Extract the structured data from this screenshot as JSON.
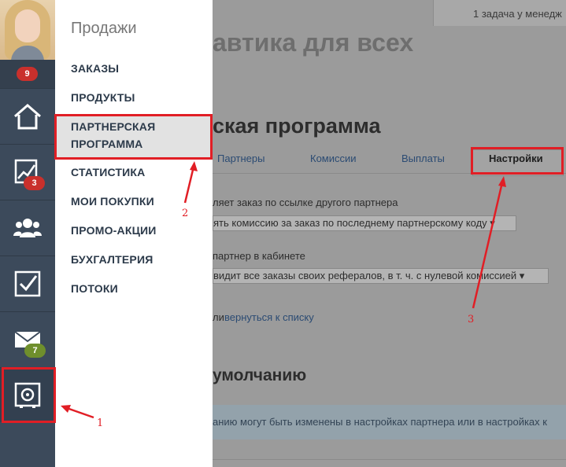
{
  "header": {
    "notice": "1 задача у менедж",
    "page_title": "автика для всех"
  },
  "sidebar": {
    "badges": {
      "top": "9",
      "stats": "3",
      "mail": "7"
    },
    "icons": [
      "home-icon",
      "chart-icon",
      "users-icon",
      "checkbox-icon",
      "mail-icon",
      "safe-icon"
    ]
  },
  "menu": {
    "title": "Продажи",
    "items": [
      "ЗАКАЗЫ",
      "ПРОДУКТЫ",
      "ПАРТНЕРСКАЯ",
      "ПРОГРАММА",
      "СТАТИСТИКА",
      "МОИ ПОКУПКИ",
      "ПРОМО-АКЦИИ",
      "БУХГАЛТЕРИЯ",
      "ПОТОКИ"
    ]
  },
  "main": {
    "section_title": "ская программа",
    "tabs": [
      "Партнеры",
      "Комиссии",
      "Выплаты",
      "Настройки"
    ],
    "field1_label": "ляет заказ по ссылке другого партнера",
    "field1_value": "ять комиссию за заказ по последнему партнерскому коду ▾",
    "field2_label": "партнер в кабинете",
    "field2_value": "видит все заказы своих рефералов, в т. ч. с нулевой комиссией ▾",
    "cancel_prefix": "ли",
    "back_link": "вернуться к списку",
    "defaults_title": "умолчанию",
    "defaults_note": "анию могут быть изменены в настройках партнера или в настройках к"
  },
  "annotations": {
    "n1": "1",
    "n2": "2",
    "n3": "3"
  },
  "colors": {
    "annotation": "#e11e25",
    "sidebar": "#3c4a5b",
    "menu_text": "#2c3a4a"
  }
}
